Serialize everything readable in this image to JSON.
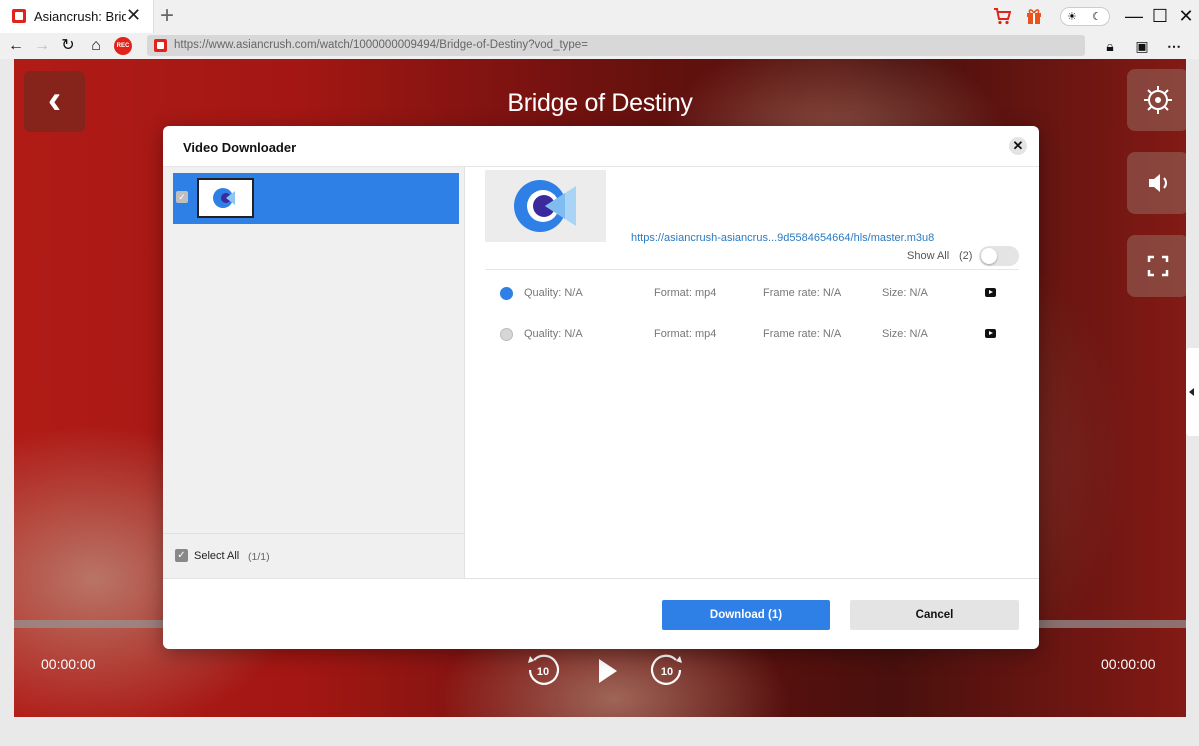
{
  "browser": {
    "tab_title": "Asiancrush: Bridg",
    "url": "https://www.asiancrush.com/watch/1000000009494/Bridge-of-Destiny?vod_type=",
    "rec_label": "REC",
    "colors": {
      "accent": "#e0231b",
      "cart": "#e0231b",
      "gift": "#e8541b"
    }
  },
  "video": {
    "title": "Bridge of Destiny",
    "time_current": "00:00:00",
    "time_total": "00:00:00",
    "rewind_label": "10",
    "forward_label": "10"
  },
  "dialog": {
    "title": "Video Downloader",
    "source_url": "https://asiancrush-asiancrus...9d5584654664/hls/master.m3u8",
    "show_all_label": "Show All",
    "show_all_count": "(2)",
    "select_all_label": "Select All",
    "select_all_count": "(1/1)",
    "qualities": [
      {
        "quality": "Quality: N/A",
        "format": "Format: mp4",
        "frame_rate": "Frame rate: N/A",
        "size": "Size: N/A",
        "selected": true
      },
      {
        "quality": "Quality: N/A",
        "format": "Format: mp4",
        "frame_rate": "Frame rate: N/A",
        "size": "Size: N/A",
        "selected": false
      }
    ],
    "download_label": "Download (1)",
    "cancel_label": "Cancel",
    "colors": {
      "primary": "#2e7fe6",
      "link": "#2a7ac0"
    }
  }
}
